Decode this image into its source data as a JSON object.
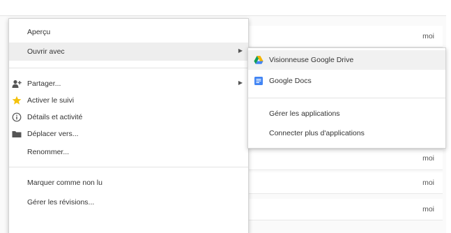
{
  "file_list": {
    "owners": [
      "moi",
      "moi",
      "moi",
      "moi"
    ]
  },
  "context_menu": {
    "items": [
      {
        "label": "Aperçu"
      },
      {
        "label": "Ouvrir avec",
        "has_submenu": true
      },
      {
        "label": "Partager...",
        "has_submenu": true,
        "icon": "share-person-icon"
      },
      {
        "label": "Activer le suivi",
        "icon": "star-icon"
      },
      {
        "label": "Détails et activité",
        "icon": "info-icon"
      },
      {
        "label": "Déplacer vers...",
        "icon": "folder-icon"
      },
      {
        "label": "Renommer..."
      },
      {
        "label": "Marquer comme non lu"
      },
      {
        "label": "Gérer les révisions..."
      }
    ]
  },
  "submenu": {
    "apps": [
      {
        "label": "Visionneuse Google Drive",
        "icon": "google-drive-icon"
      },
      {
        "label": "Google Docs",
        "icon": "google-docs-icon"
      }
    ],
    "actions": [
      {
        "label": "Gérer les applications"
      },
      {
        "label": "Connecter plus d'applications"
      }
    ]
  },
  "colors": {
    "star": "#f4c20d",
    "drive_green": "#0f9d58",
    "drive_yellow": "#f4b400",
    "drive_blue": "#4285f4",
    "docs_blue": "#4285f4",
    "highlight": "#eeeeee"
  }
}
